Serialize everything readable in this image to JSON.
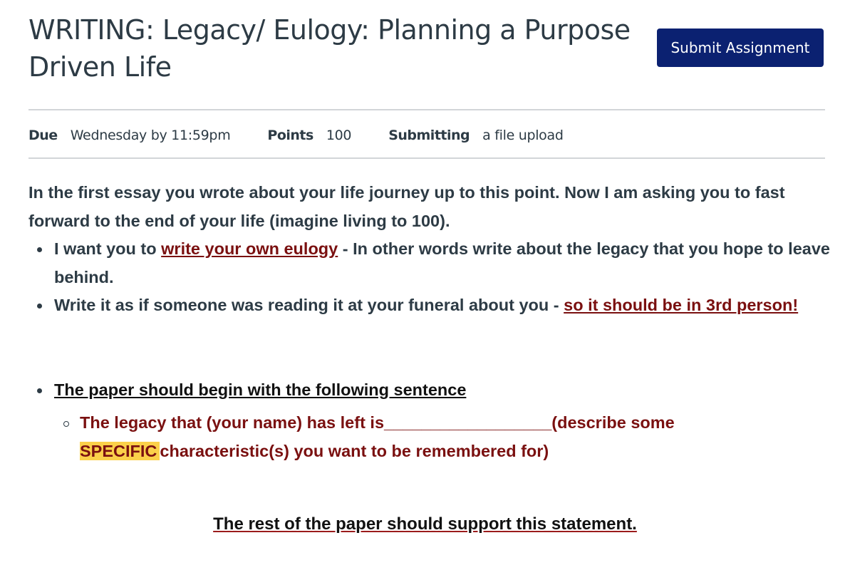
{
  "header": {
    "title": "WRITING: Legacy/ Eulogy: Planning a Purpose Driven Life",
    "submit_label": "Submit Assignment"
  },
  "meta": {
    "due_label": "Due",
    "due_value": "Wednesday by 11:59pm",
    "points_label": "Points",
    "points_value": "100",
    "submitting_label": "Submitting",
    "submitting_value": "a file upload"
  },
  "content": {
    "intro": "In the first essay you wrote about your life journey up to this point. Now I am asking you to fast forward to the end of your life (imagine living to 100).",
    "bullet1_prefix": "I want you to ",
    "bullet1_link": "write your own eulogy",
    "bullet1_suffix": " - In other words write about the legacy that you hope to leave behind.",
    "bullet2_prefix": "Write it as if someone was reading it at your funeral about you - ",
    "bullet2_link": "so it should be in 3rd person!",
    "bullet3": "The paper should begin with the following sentence",
    "sub_prefix": "The legacy that (your name) has left is",
    "sub_blank": "__________________",
    "sub_mid": "(describe some ",
    "sub_highlight": "SPECIFIC",
    "sub_suffix": "characteristic(s) you want to be remembered for)",
    "closing": "The rest of the paper should support this statement."
  },
  "colors": {
    "submit_button_bg": "#0b2171",
    "emphasis_red": "#7a1010",
    "highlight_yellow": "#fbd04a",
    "body_text": "#2d3b45"
  }
}
